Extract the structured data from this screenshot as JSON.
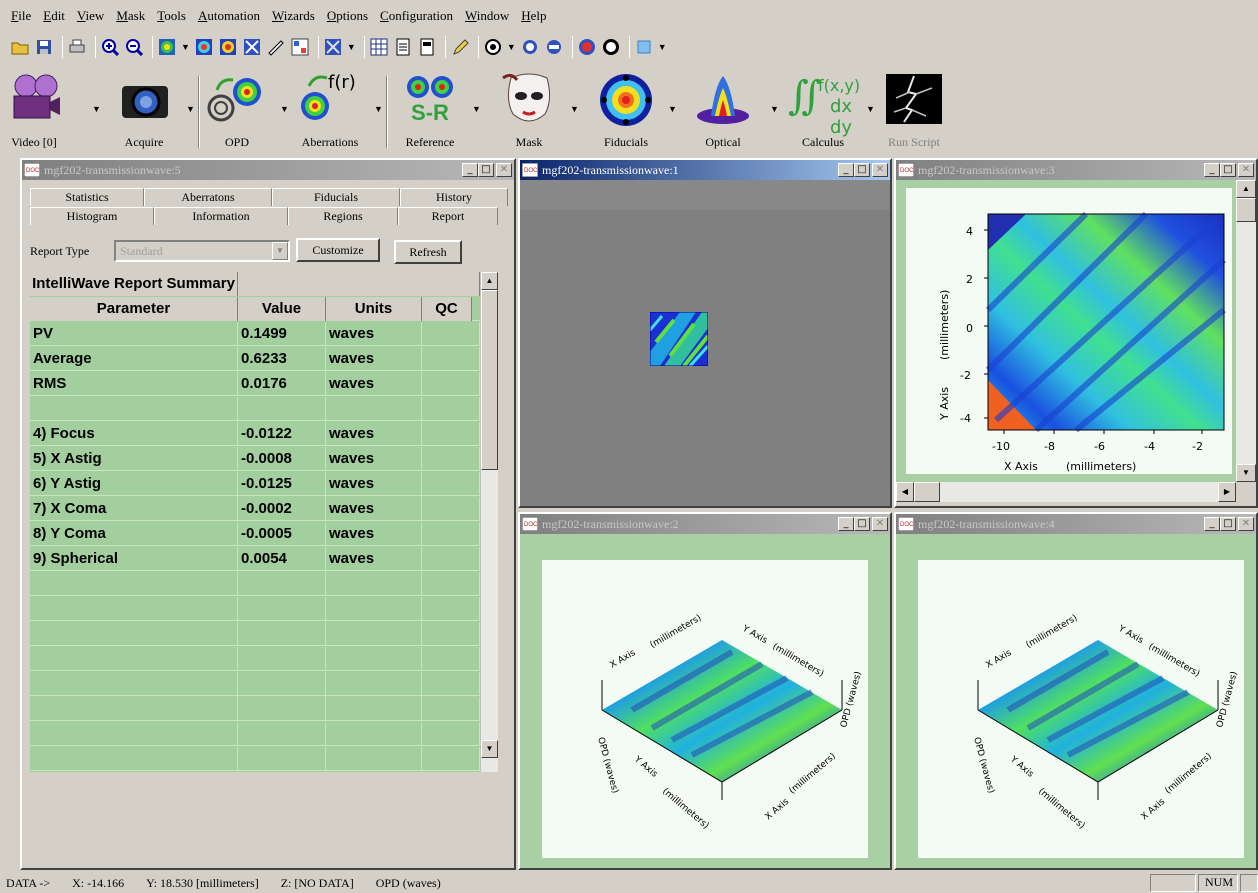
{
  "menu": [
    "File",
    "Edit",
    "View",
    "Mask",
    "Tools",
    "Automation",
    "Wizards",
    "Options",
    "Configuration",
    "Window",
    "Help"
  ],
  "toolbar_icons": [
    "open-icon",
    "save-icon",
    "print-icon",
    "zoom-in-icon",
    "zoom-out-icon",
    "wavefront-icon",
    "wave-color-icon",
    "wave-color-2-icon",
    "crosshair-icon",
    "draw-icon",
    "grid-icon",
    "pattern-icon",
    "table-icon",
    "doc-icon",
    "doc-2-icon",
    "pencil-icon",
    "target-icon",
    "ring-icon",
    "ring-2-icon",
    "s-icon",
    "r-icon",
    "cube-icon"
  ],
  "big_toolbar": {
    "video": "Video [0]",
    "acquire": "Acquire",
    "opd": "OPD",
    "aberrations": "Aberrations",
    "aberr_formula": "f(r)",
    "reference": "Reference",
    "reference_logo": "S-R",
    "mask": "Mask",
    "fiducials": "Fiducials",
    "optical": "Optical",
    "calculus": "Calculus",
    "calculus_formula_top": "f(x,y)",
    "calculus_formula_bottom": "dx dy",
    "run_script": "Run Script"
  },
  "report_window": {
    "title": "mgf202-transmissionwave:5",
    "tabs_row1": [
      "Statistics",
      "Aberratons",
      "Fiducials",
      "History"
    ],
    "tabs_row2": [
      "Histogram",
      "Information",
      "Regions",
      "Report"
    ],
    "report_type_label": "Report Type",
    "report_type_value": "Standard",
    "customize": "Customize",
    "refresh": "Refresh",
    "table_title": "IntelliWave Report Summary",
    "headers": [
      "Parameter",
      "Value",
      "Units",
      "QC"
    ],
    "rows": [
      {
        "param": "PV",
        "value": "0.1499",
        "units": "waves"
      },
      {
        "param": "Average",
        "value": "0.6233",
        "units": "waves"
      },
      {
        "param": "RMS",
        "value": "0.0176",
        "units": "waves"
      },
      {
        "param": "",
        "value": "",
        "units": ""
      },
      {
        "param": "4) Focus",
        "value": "-0.0122",
        "units": "waves"
      },
      {
        "param": "5) X Astig",
        "value": "-0.0008",
        "units": "waves"
      },
      {
        "param": "6) Y Astig",
        "value": "-0.0125",
        "units": "waves"
      },
      {
        "param": "7) X Coma",
        "value": "-0.0002",
        "units": "waves"
      },
      {
        "param": "8) Y Coma",
        "value": "-0.0005",
        "units": "waves"
      },
      {
        "param": "9) Spherical",
        "value": "0.0054",
        "units": "waves"
      }
    ]
  },
  "win1": {
    "title": "mgf202-transmissionwave:1"
  },
  "win3": {
    "title": "mgf202-transmissionwave:3",
    "y_ticks": [
      "4",
      "2",
      "0",
      "-2",
      "-4"
    ],
    "x_ticks": [
      "-10",
      "-8",
      "-6",
      "-4",
      "-2"
    ],
    "x_label": "X Axis",
    "x_unit": "(millimeters)",
    "y_label": "Y Axis",
    "y_unit": "(millimeters)"
  },
  "win2": {
    "title": "mgf202-transmissionwave:2"
  },
  "win4": {
    "title": "mgf202-transmissionwave:4"
  },
  "surface_labels": {
    "x_axis": "X Axis",
    "y_axis": "Y Axis",
    "z_axis": "OPD (waves)",
    "units": "(millimeters)"
  },
  "status": {
    "data": "DATA ->",
    "x": "X: -14.166",
    "y": "Y: 18.530 [millimeters]",
    "z": "Z: [NO DATA]",
    "mode": "OPD (waves)",
    "num": "NUM"
  }
}
